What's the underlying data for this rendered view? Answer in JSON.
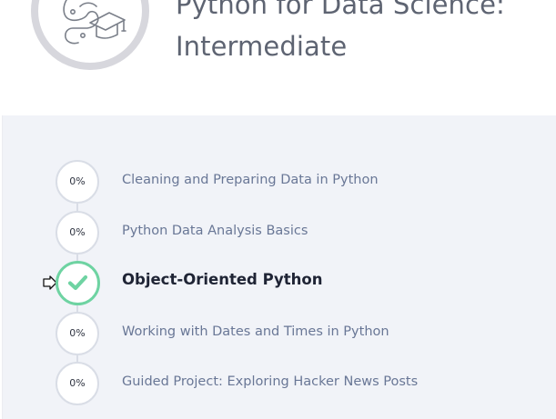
{
  "course": {
    "title_line1": "Python for Data Science:",
    "title_line2": "Intermediate",
    "icon": "python-graduation-cap-icon",
    "ring_color": "#d7d7dd"
  },
  "missions": [
    {
      "progress": "0%",
      "label": "Cleaning and Preparing Data in Python",
      "status": "not-started"
    },
    {
      "progress": "0%",
      "label": "Python Data Analysis Basics",
      "status": "not-started"
    },
    {
      "label": "Object-Oriented Python",
      "status": "completed",
      "icon": "check-icon"
    },
    {
      "progress": "0%",
      "label": "Working with Dates and Times in Python",
      "status": "not-started"
    },
    {
      "progress": "0%",
      "label": "Guided Project: Exploring Hacker News Posts",
      "status": "not-started"
    }
  ],
  "colors": {
    "background": "#f1f3f8",
    "muted_text": "#697796",
    "active_text": "#1f2435",
    "complete": "#6ed3a2",
    "timeline": "#d9dde6"
  }
}
